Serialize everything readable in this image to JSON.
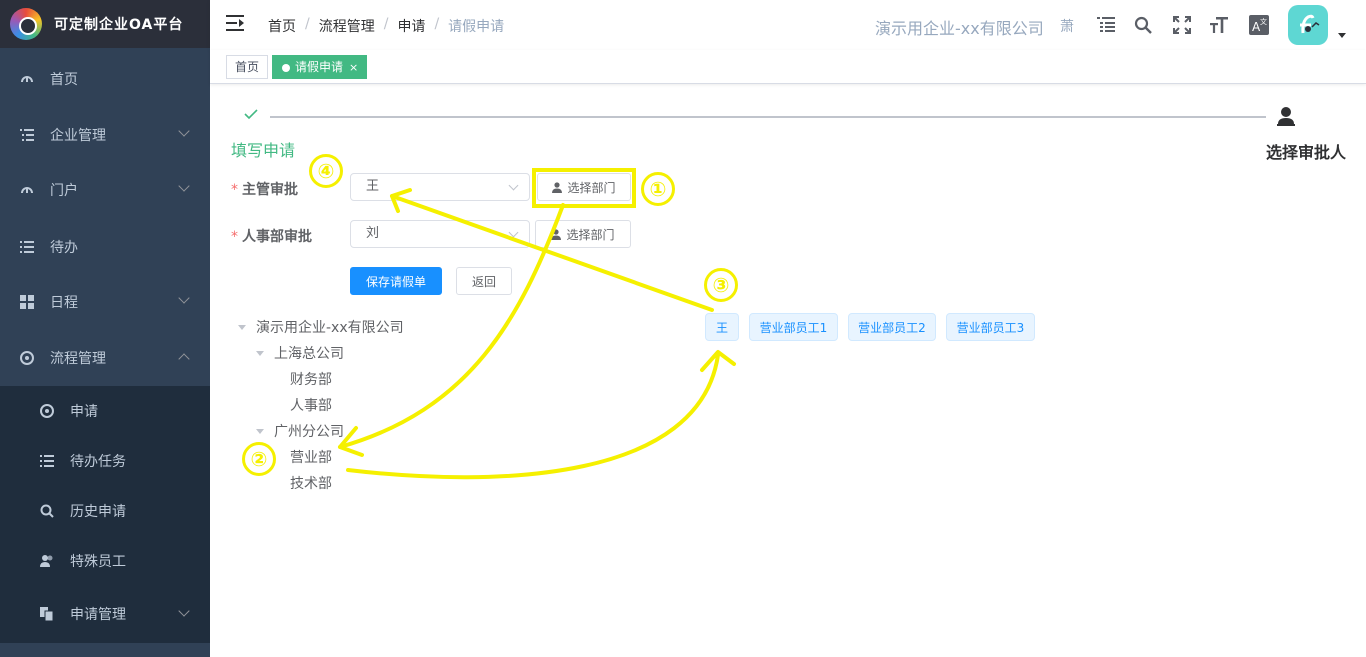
{
  "app": {
    "title": "可定制企业OA平台"
  },
  "sidebar": {
    "items": [
      {
        "label": "首页"
      },
      {
        "label": "企业管理"
      },
      {
        "label": "门户"
      },
      {
        "label": "待办"
      },
      {
        "label": "日程"
      },
      {
        "label": "流程管理"
      }
    ],
    "sub_items": [
      {
        "label": "申请"
      },
      {
        "label": "待办任务"
      },
      {
        "label": "历史申请"
      },
      {
        "label": "特殊员工"
      },
      {
        "label": "申请管理"
      }
    ]
  },
  "header": {
    "breadcrumb": [
      "首页",
      "流程管理",
      "申请",
      "请假申请"
    ],
    "company": "演示用企业-xx有限公司",
    "user_text": "萧"
  },
  "tags": {
    "home": "首页",
    "active": "请假申请",
    "close": "×"
  },
  "steps": {
    "step1": "填写申请",
    "step2": "选择审批人"
  },
  "form": {
    "manager_label": "主管审批",
    "manager_value": "王",
    "hr_label": "人事部审批",
    "hr_value": "刘",
    "select_dept": "选择部门",
    "required_mark": "*",
    "save": "保存请假单",
    "back": "返回"
  },
  "tree": {
    "root": "演示用企业-xx有限公司",
    "shanghai": "上海总公司",
    "finance": "财务部",
    "hr": "人事部",
    "guangzhou": "广州分公司",
    "sales": "营业部",
    "tech": "技术部"
  },
  "employees": [
    "王",
    "营业部员工1",
    "营业部员工2",
    "营业部员工3"
  ],
  "annotations": [
    "①",
    "②",
    "③",
    "④"
  ],
  "colors": {
    "sidebar_bg": "#304156",
    "submenu_bg": "#1f2d3d",
    "accent_green": "#42b983",
    "primary_blue": "#1890ff",
    "annotation_yellow": "#f5f000"
  }
}
